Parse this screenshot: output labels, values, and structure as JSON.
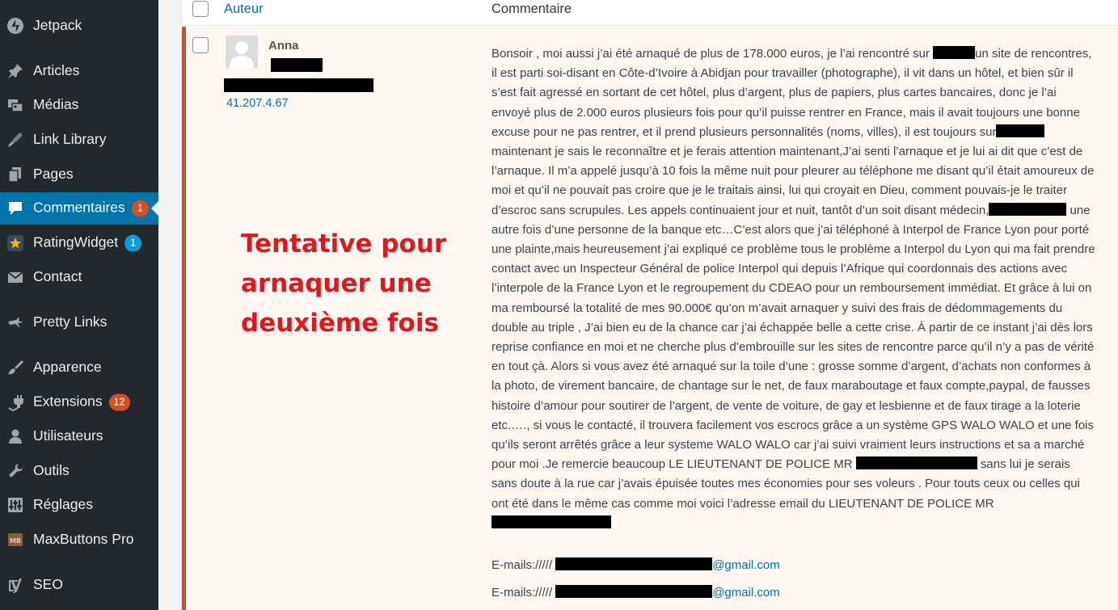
{
  "sidebar": {
    "items": [
      {
        "id": "jetpack",
        "label": "Jetpack",
        "icon": "jetpack-icon"
      },
      {
        "id": "articles",
        "label": "Articles",
        "icon": "pin-icon"
      },
      {
        "id": "medias",
        "label": "Médias",
        "icon": "media-icon"
      },
      {
        "id": "link-library",
        "label": "Link Library",
        "icon": "link-icon"
      },
      {
        "id": "pages",
        "label": "Pages",
        "icon": "pages-icon"
      },
      {
        "id": "commentaires",
        "label": "Commentaires",
        "icon": "comment-bubble-icon",
        "badge": "1",
        "active": true
      },
      {
        "id": "ratingwidget",
        "label": "RatingWidget",
        "icon": "star-icon",
        "badge": "1"
      },
      {
        "id": "contact",
        "label": "Contact",
        "icon": "envelope-icon"
      },
      {
        "id": "pretty-links",
        "label": "Pretty Links",
        "icon": "star-link-icon"
      },
      {
        "id": "apparence",
        "label": "Apparence",
        "icon": "paintbrush-icon"
      },
      {
        "id": "extensions",
        "label": "Extensions",
        "icon": "plugin-icon",
        "badge": "12"
      },
      {
        "id": "utilisateurs",
        "label": "Utilisateurs",
        "icon": "user-icon"
      },
      {
        "id": "outils",
        "label": "Outils",
        "icon": "wrench-icon"
      },
      {
        "id": "reglages",
        "label": "Réglages",
        "icon": "settings-sliders-icon"
      },
      {
        "id": "maxbuttons",
        "label": "MaxButtons Pro",
        "icon": "mb-logo-icon"
      },
      {
        "id": "seo",
        "label": "SEO",
        "icon": "yoast-icon"
      }
    ],
    "badge_colors": {
      "comments": "#d54e21",
      "rating": "#00a0d2",
      "extensions": "#d54e21"
    }
  },
  "table": {
    "headers": {
      "author": "Auteur",
      "comment": "Commentaire"
    }
  },
  "comment": {
    "author_name": "Anna",
    "author_ip": "41.207.4.67",
    "overlay_text": "Tentative pour arnaquer une deuxième fois",
    "body": {
      "s1": "Bonsoir , moi aussi j’ai été arnaqué de plus de 178.000 euros, je l’ai rencontré sur ",
      "s2": "un site de rencontres, il est parti soi-disant en Côte-d’Ivoire à Abidjan pour travailler (photographe), il vit dans un hôtel, et bien sûr il s’est fait agressé en sortant de cet hôtel, plus d’argent, plus de papiers, plus cartes bancaires, donc je l’ai envoyé plus de 2.000 euros plusieurs fois pour qu’il puisse rentrer en France, mais il avait toujours une bonne excuse pour ne pas rentrer, et il prend plusieurs personnalités (noms, villes), il est toujours sur",
      "s3": "maintenant je sais le reconnaître et je ferais attention maintenant,J’ai senti l’arnaque et je lui ai dit que c’est de l’arnaque. Il m’a appelé jusqu’à 10 fois la même nuit pour pleurer au téléphone me disant qu’il était amoureux de moi et qu’il ne pouvait pas croire que je le traitais ainsi, lui qui croyait en Dieu, comment pouvais-je le traiter d’escroc sans scrupules. Les appels continuaient jour et nuit, tantôt d’un soit disant médecin,",
      "s4": " une autre fois d’une personne de la banque etc…C’est alors que j’ai téléphoné à Interpol de France Lyon pour porté une plainte,mais heureusement j’ai expliqué ce problème tous le problème a Interpol du Lyon qui ma fait prendre contact avec un Inspecteur Général de police Interpol qui depuis l’Afrique qui coordonnais des actions avec l’interpole de la France Lyon et le regroupement du CDEAO pour un remboursement immédiat. Et grâce à lui on ma remboursé la totalité de mes 90.000€ qu’on m’avait arnaquer y suivi des frais de dédommagements du double au triple , J’ai bien eu de la chance car j’ai échappée belle a cette crise. À partir de ce instant j’ai dès lors reprise confiance en moi et ne cherche plus d’embrouille sur les sites de rencontre parce qu’il n’y a pas de vérité en tout çà. Alors si vous avez été arnaqué sur la toile d’une : grosse somme d’argent, d’achats non conformes à la photo, de virement bancaire, de chantage sur le net, de faux maraboutage et faux compte,paypal, de fausses histoire d’amour pour soutirer de l’argent, de vente de voiture, de gay et lesbienne et de faux tirage a la loterie etc.…., si vous le contacté, il trouvera facilement vos escrocs grâce a un système GPS WALO WALO et une fois qu’ils seront arrêtés grâce a leur systeme WALO WALO car j’ai suivi vraiment leurs instructions et sa a marché pour moi .Je remercie beaucoup LE LIEUTENANT DE POLICE MR ",
      "s5": " sans lui je serais sans doute à la rue car j’avais épuisée toutes mes économies pour ses voleurs . Pour touts ceux ou celles qui ont été dans le même cas comme moi voici l’adresse email du LIEUTENANT DE POLICE MR"
    },
    "email_prefix": "E-mails:///// ",
    "email_domain": "@gmail.com"
  },
  "colors": {
    "sidebar_bg": "#23282d",
    "active_bg": "#0073aa",
    "link": "#0073aa",
    "unapproved_bar": "#d54e21",
    "overlay_red": "#e0171e"
  }
}
